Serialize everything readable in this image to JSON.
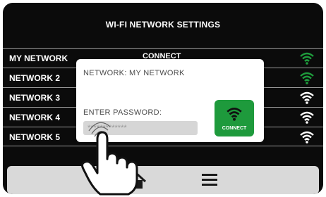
{
  "header": {
    "title": "WI-FI NETWORK SETTINGS"
  },
  "networks": [
    {
      "name": "MY NETWORK",
      "signal_icon": "wifi-signal-icon",
      "color": "#1e9a3c",
      "row_action": "CONNECT"
    },
    {
      "name": "NETWORK 2",
      "signal_icon": "wifi-signal-icon",
      "color": "#1e9a3c"
    },
    {
      "name": "NETWORK 3",
      "signal_icon": "wifi-signal-icon",
      "color": "#ffffff"
    },
    {
      "name": "NETWORK 4",
      "signal_icon": "wifi-signal-icon",
      "color": "#ffffff"
    },
    {
      "name": "NETWORK 5",
      "signal_icon": "wifi-signal-icon",
      "color": "#ffffff"
    }
  ],
  "popup": {
    "network_label": "NETWORK: MY NETWORK",
    "password_label": "ENTER PASSWORD:",
    "password_value": "*************",
    "connect_label": "CONNECT",
    "connect_icon": "wifi-icon"
  },
  "footer": {
    "home_icon": "home-icon",
    "menu_icon": "menu-icon"
  },
  "colors": {
    "accent": "#1e9a3c",
    "screen_bg": "#0b0b0b",
    "popup_bg": "#ffffff",
    "footer_bg": "#d9d9d9",
    "field_bg": "#d6d6d6"
  }
}
